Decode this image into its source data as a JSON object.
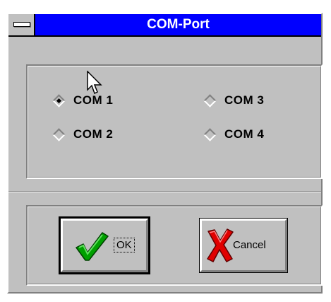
{
  "window": {
    "title": "COM-Port"
  },
  "ports": [
    {
      "label": "COM 1",
      "selected": true
    },
    {
      "label": "COM 2",
      "selected": false
    },
    {
      "label": "COM 3",
      "selected": false
    },
    {
      "label": "COM 4",
      "selected": false
    }
  ],
  "buttons": {
    "ok_label": "OK",
    "cancel_label": "Cancel"
  },
  "colors": {
    "titlebar": "#0000ff",
    "face": "#c0c0c0",
    "check_green": "#00a000",
    "cross_red": "#e00000"
  },
  "icons": {
    "system_menu": "system-menu-icon",
    "ok": "checkmark-icon",
    "cancel": "red-x-icon",
    "pointer": "mouse-pointer-icon"
  }
}
